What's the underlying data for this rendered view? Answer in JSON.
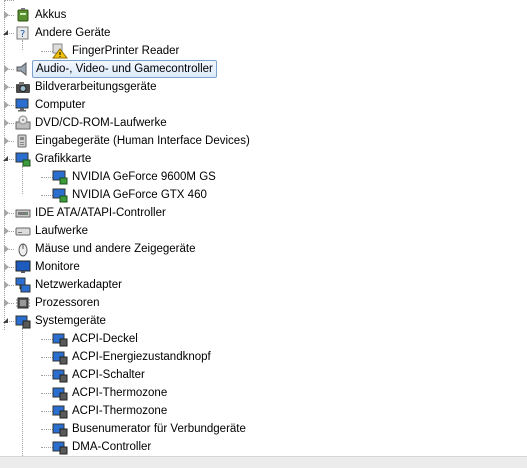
{
  "tree": {
    "items": [
      {
        "label": "Akkus",
        "icon": "battery-icon",
        "level": 0,
        "state": "collapsed"
      },
      {
        "label": "Andere Geräte",
        "icon": "unknown-device-icon",
        "level": 0,
        "state": "expanded"
      },
      {
        "label": "FingerPrinter Reader",
        "icon": "warning-device-icon",
        "level": 1,
        "state": "leaf"
      },
      {
        "label": "Audio-, Video- und Gamecontroller",
        "icon": "speaker-icon",
        "level": 0,
        "state": "collapsed",
        "selected": true
      },
      {
        "label": "Bildverarbeitungsgeräte",
        "icon": "camera-icon",
        "level": 0,
        "state": "collapsed"
      },
      {
        "label": "Computer",
        "icon": "computer-icon",
        "level": 0,
        "state": "collapsed"
      },
      {
        "label": "DVD/CD-ROM-Laufwerke",
        "icon": "cdrom-icon",
        "level": 0,
        "state": "collapsed"
      },
      {
        "label": "Eingabegeräte (Human Interface Devices)",
        "icon": "hid-icon",
        "level": 0,
        "state": "collapsed"
      },
      {
        "label": "Grafikkarte",
        "icon": "display-adapter-icon",
        "level": 0,
        "state": "expanded"
      },
      {
        "label": "NVIDIA GeForce 9600M GS",
        "icon": "display-adapter-icon",
        "level": 1,
        "state": "leaf"
      },
      {
        "label": "NVIDIA GeForce GTX 460",
        "icon": "display-adapter-icon",
        "level": 1,
        "state": "leaf"
      },
      {
        "label": "IDE ATA/ATAPI-Controller",
        "icon": "ide-controller-icon",
        "level": 0,
        "state": "collapsed"
      },
      {
        "label": "Laufwerke",
        "icon": "disk-drive-icon",
        "level": 0,
        "state": "collapsed"
      },
      {
        "label": "Mäuse und andere Zeigegeräte",
        "icon": "mouse-icon",
        "level": 0,
        "state": "collapsed"
      },
      {
        "label": "Monitore",
        "icon": "monitor-icon",
        "level": 0,
        "state": "collapsed"
      },
      {
        "label": "Netzwerkadapter",
        "icon": "network-adapter-icon",
        "level": 0,
        "state": "collapsed"
      },
      {
        "label": "Prozessoren",
        "icon": "processor-icon",
        "level": 0,
        "state": "collapsed"
      },
      {
        "label": "Systemgeräte",
        "icon": "system-device-icon",
        "level": 0,
        "state": "expanded"
      },
      {
        "label": "ACPI-Deckel",
        "icon": "system-device-icon",
        "level": 1,
        "state": "leaf"
      },
      {
        "label": "ACPI-Energiezustandknopf",
        "icon": "system-device-icon",
        "level": 1,
        "state": "leaf"
      },
      {
        "label": "ACPI-Schalter",
        "icon": "system-device-icon",
        "level": 1,
        "state": "leaf"
      },
      {
        "label": "ACPI-Thermozone",
        "icon": "system-device-icon",
        "level": 1,
        "state": "leaf"
      },
      {
        "label": "ACPI-Thermozone",
        "icon": "system-device-icon",
        "level": 1,
        "state": "leaf"
      },
      {
        "label": "Busenumerator für Verbundgeräte",
        "icon": "system-device-icon",
        "level": 1,
        "state": "leaf"
      },
      {
        "label": "DMA-Controller",
        "icon": "system-device-icon",
        "level": 1,
        "state": "leaf"
      }
    ]
  },
  "colors": {
    "selection_border": "#7da2ce",
    "selection_fill": "#dcebfc",
    "expander_collapsed": "#a6a6a6",
    "expander_expanded": "#404040",
    "dotted_line": "#a0a0a0"
  }
}
